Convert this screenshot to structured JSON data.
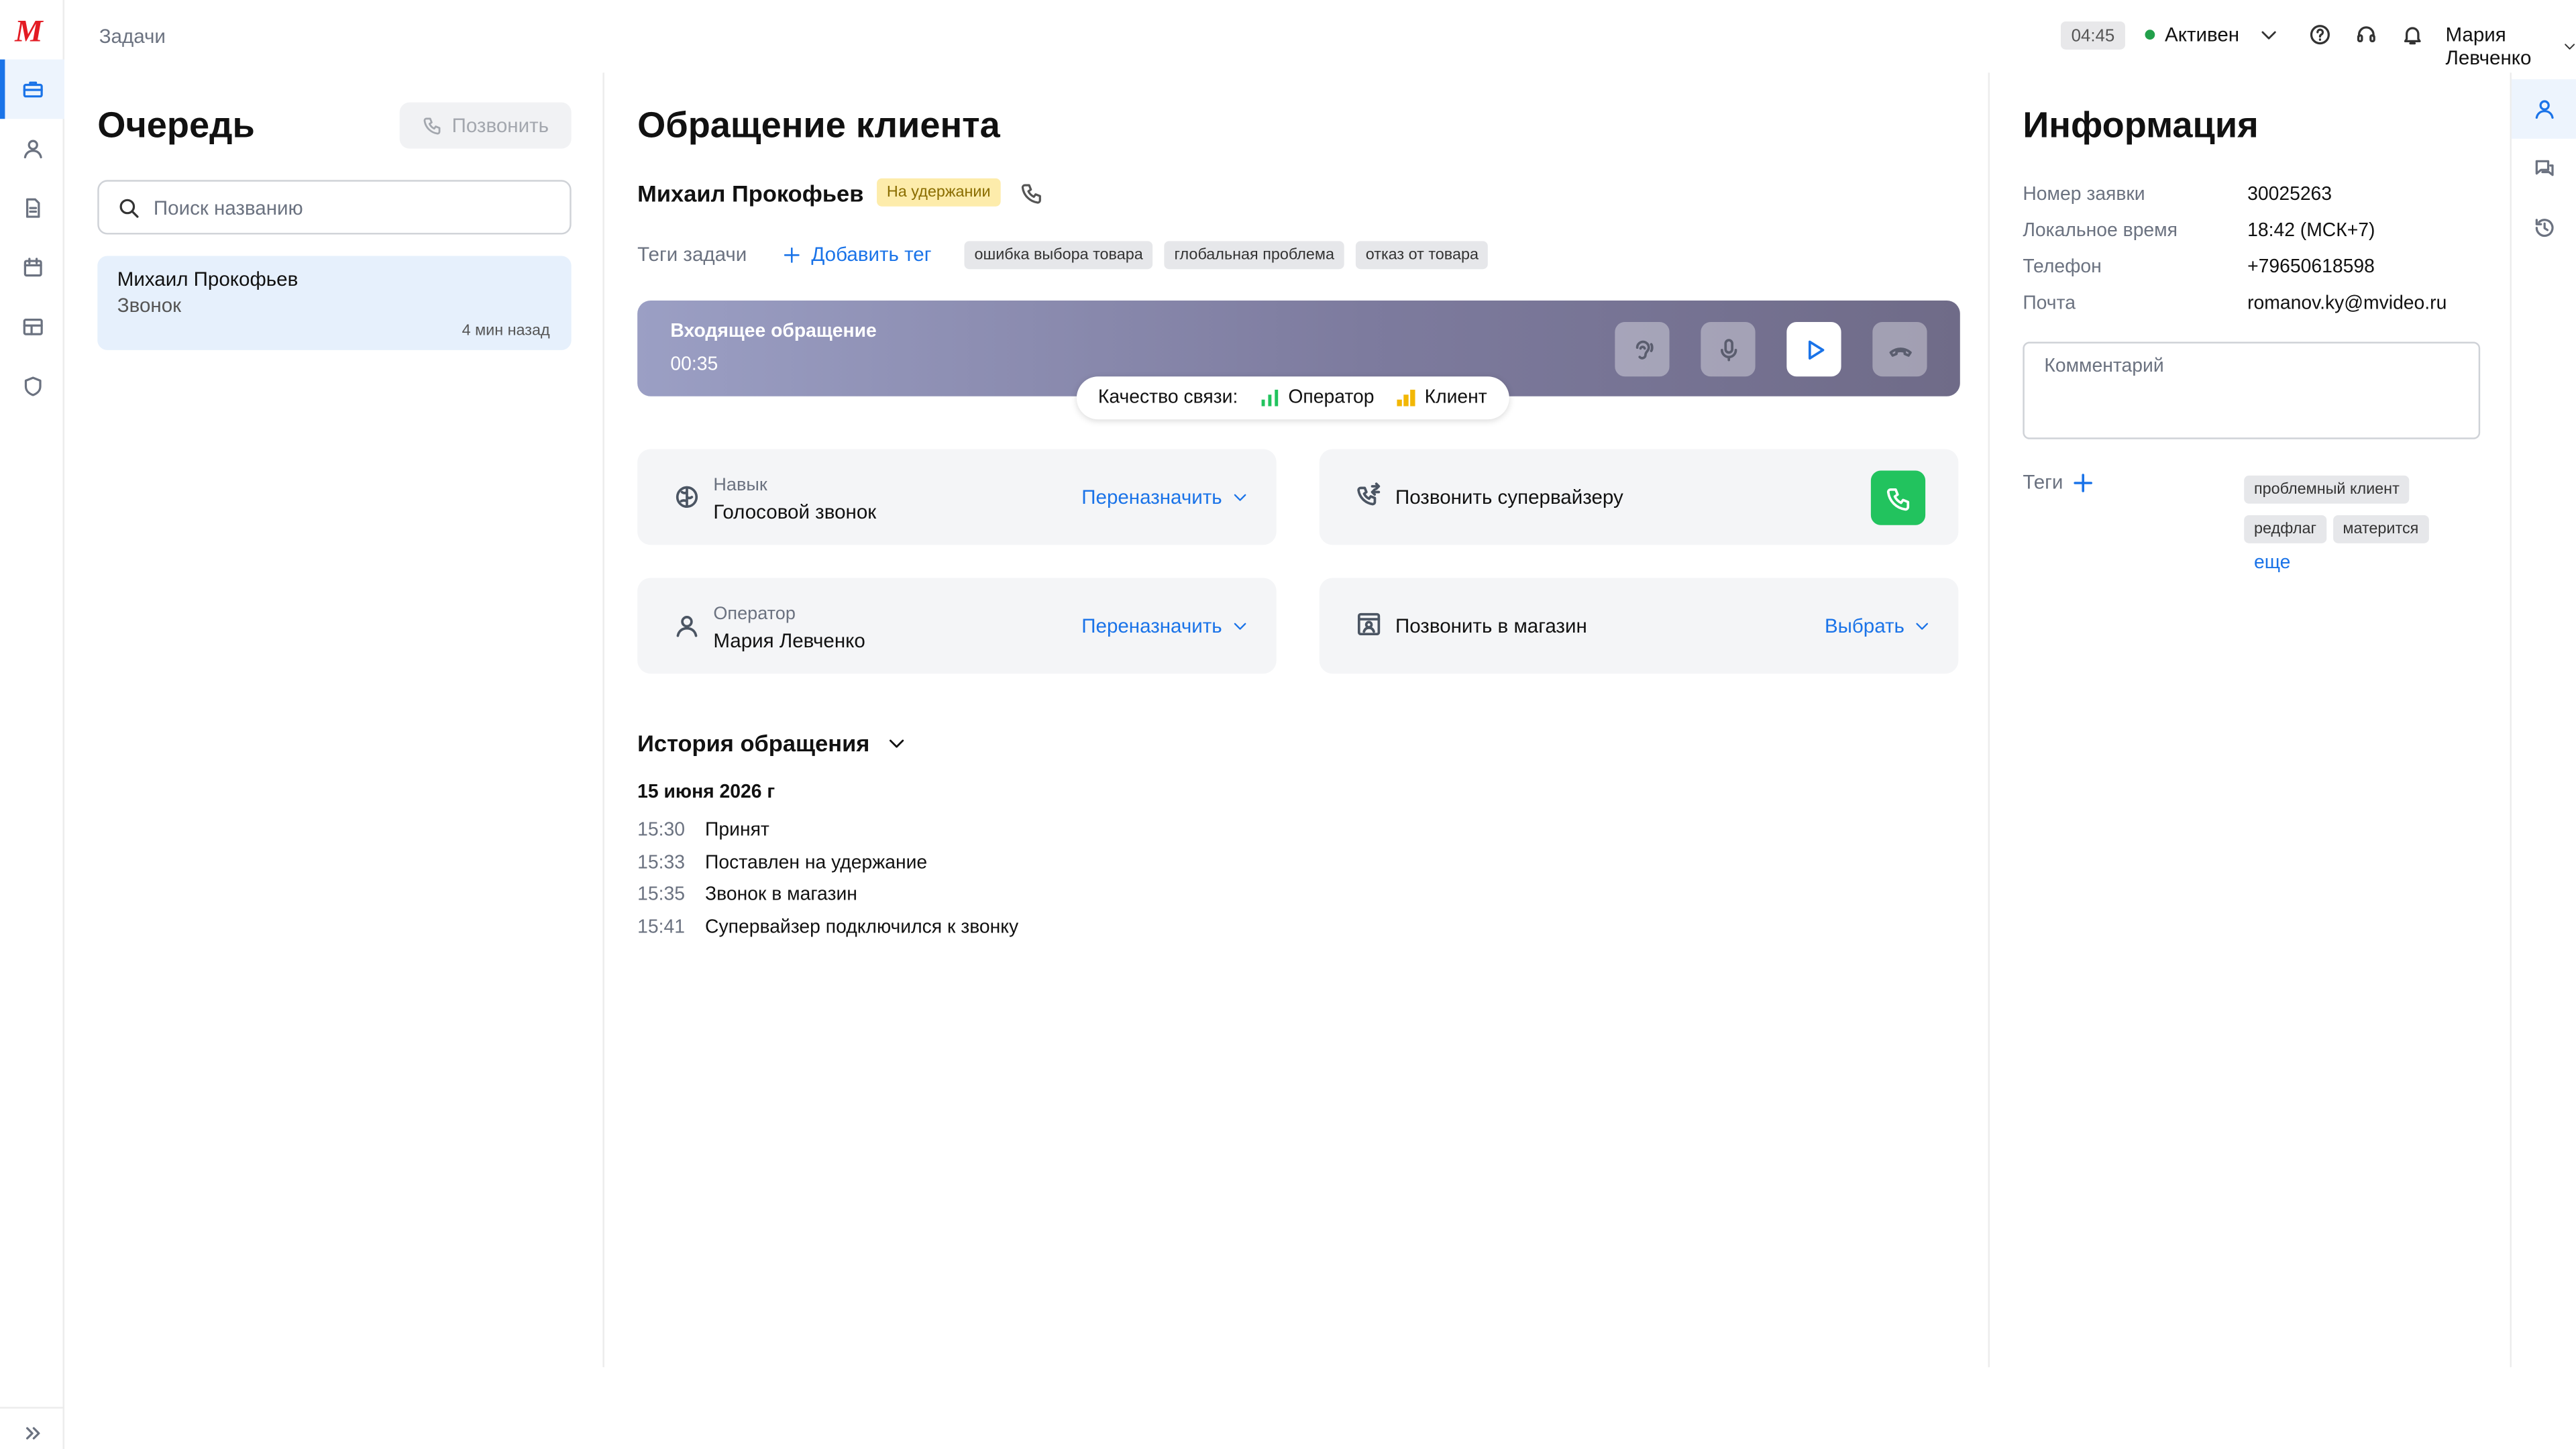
{
  "app": {
    "logo": "М",
    "breadcrumb": "Задачи"
  },
  "header": {
    "timer": "04:45",
    "status": "Активен",
    "status_color": "#22a04b",
    "user_name": "Мария Левченко",
    "icons": [
      "help-icon",
      "headset-icon",
      "bell-icon"
    ]
  },
  "left_nav": {
    "items": [
      "briefcase-icon",
      "user-icon",
      "document-icon",
      "calendar-icon",
      "table-icon",
      "shield-icon"
    ],
    "active_index": 0,
    "expand_icon": "double-chevron-right-icon"
  },
  "queue": {
    "title": "Очередь",
    "call_button": "Позвонить",
    "search_placeholder": "Поиск названию",
    "items": [
      {
        "name": "Михаил Прокофьев",
        "type": "Звонок",
        "time": "4 мин назад"
      }
    ]
  },
  "main": {
    "title": "Обращение клиента",
    "client_name": "Михаил Прокофьев",
    "hold_badge": "На удержании",
    "tags_label": "Теги задачи",
    "add_tag": "Добавить тег",
    "tags": [
      "ошибка выбора товара",
      "глобальная проблема",
      "отказ от товара"
    ],
    "call": {
      "title": "Входящее обращение",
      "timer": "00:35"
    },
    "quality": {
      "label": "Качество связи:",
      "operator": "Оператор",
      "client": "Клиент",
      "operator_color": "#22c35e",
      "client_color": "#f2b705"
    },
    "skill": {
      "label": "Навык",
      "value": "Голосовой звонок",
      "action": "Переназначить"
    },
    "supervisor": {
      "label": "Позвонить супервайзеру",
      "button_color": "#22c35e"
    },
    "operator": {
      "label": "Оператор",
      "value": "Мария Левченко",
      "action": "Переназначить"
    },
    "store": {
      "label": "Позвонить в магазин",
      "action": "Выбрать"
    },
    "history": {
      "title": "История обращения",
      "date": "15 июня 2026 г",
      "events": [
        {
          "time": "15:30",
          "text": "Принят"
        },
        {
          "time": "15:33",
          "text": "Поставлен на удержание"
        },
        {
          "time": "15:35",
          "text": "Звонок в магазин"
        },
        {
          "time": "15:41",
          "text": "Супервайзер подключился к звонку"
        }
      ]
    }
  },
  "info": {
    "title": "Информация",
    "rows": [
      {
        "key": "Номер заявки",
        "value": "30025263"
      },
      {
        "key": "Локальное время",
        "value": "18:42 (МСК+7)"
      },
      {
        "key": "Телефон",
        "value": "+79650618598"
      },
      {
        "key": "Почта",
        "value": "romanov.ky@mvideo.ru"
      }
    ],
    "comment_placeholder": "Комментарий",
    "tags_label": "Теги",
    "tags": [
      "проблемный клиент",
      "редфлаг",
      "матерится"
    ],
    "more": "еще"
  },
  "right_nav": {
    "items": [
      "user-icon",
      "chat-icon",
      "history-icon"
    ],
    "active_index": 0
  },
  "colors": {
    "accent": "#1a73e8",
    "brand": "#e31b23"
  }
}
